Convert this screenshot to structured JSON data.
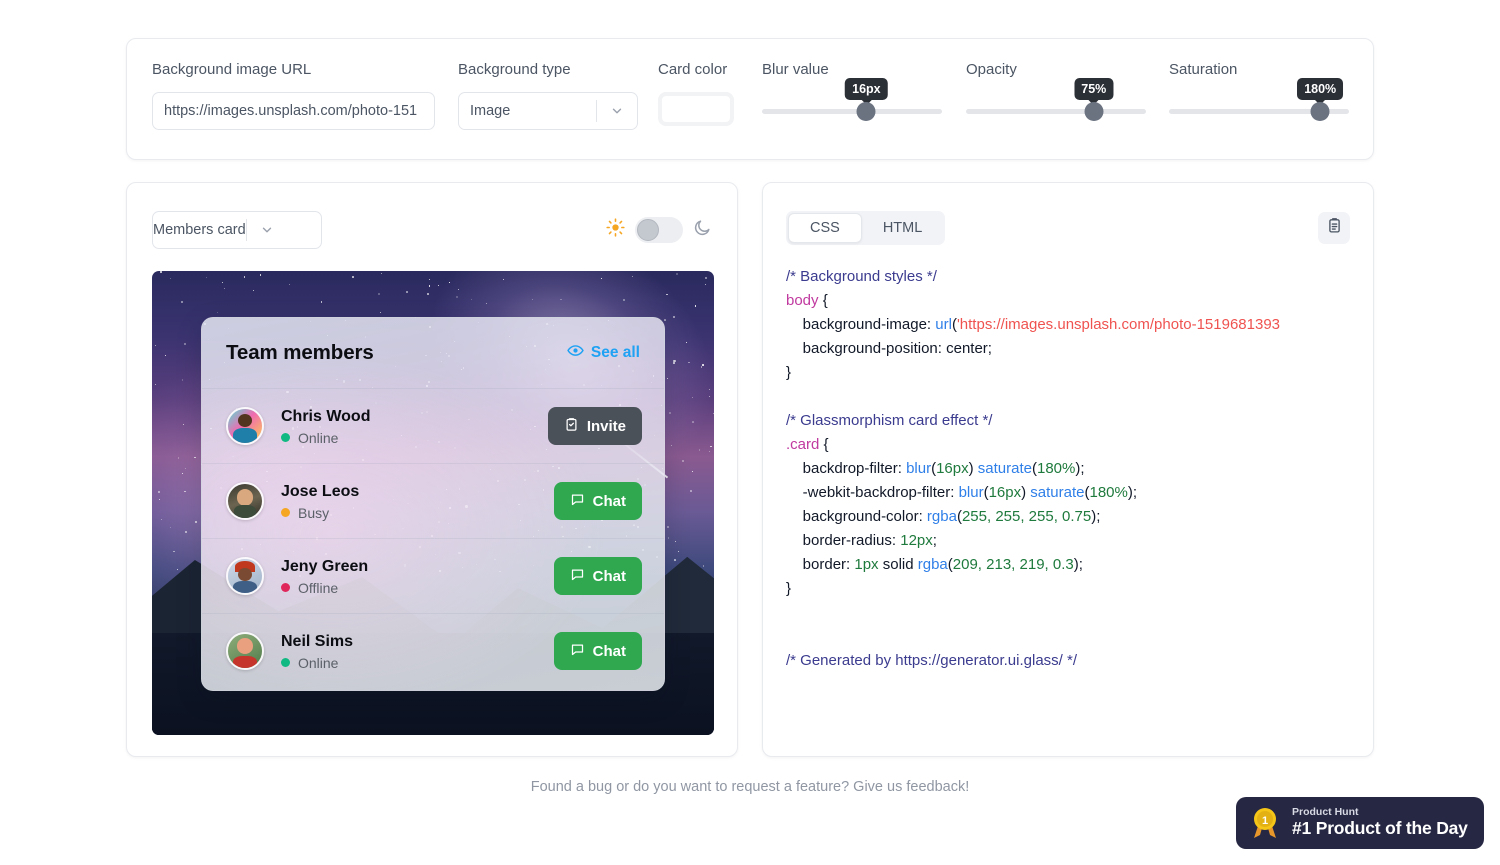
{
  "settings": {
    "background_url": {
      "label": "Background image URL",
      "value": "https://images.unsplash.com/photo-151"
    },
    "background_type": {
      "label": "Background type",
      "value": "Image"
    },
    "card_color": {
      "label": "Card color",
      "value": "#ffffff"
    },
    "blur": {
      "label": "Blur value",
      "value": "16px",
      "percent": 58
    },
    "opacity": {
      "label": "Opacity",
      "value": "75%",
      "percent": 71
    },
    "saturation": {
      "label": "Saturation",
      "value": "180%",
      "percent": 84
    }
  },
  "preview": {
    "component_select": "Members card",
    "theme": {
      "sun_icon": "sun-icon",
      "moon_icon": "moon-icon",
      "mode": "light"
    },
    "card": {
      "title": "Team members",
      "see_all": "See all",
      "see_all_icon": "eye-icon",
      "members": [
        {
          "name": "Chris Wood",
          "status": "Online",
          "status_color": "#10b981",
          "action": "Invite",
          "action_kind": "invite",
          "action_icon": "clipboard-check-icon"
        },
        {
          "name": "Jose Leos",
          "status": "Busy",
          "status_color": "#f5a623",
          "action": "Chat",
          "action_kind": "chat",
          "action_icon": "chat-bubble-icon"
        },
        {
          "name": "Jeny Green",
          "status": "Offline",
          "status_color": "#e0275c",
          "action": "Chat",
          "action_kind": "chat",
          "action_icon": "chat-bubble-icon"
        },
        {
          "name": "Neil Sims",
          "status": "Online",
          "status_color": "#10b981",
          "action": "Chat",
          "action_kind": "chat",
          "action_icon": "chat-bubble-icon"
        }
      ]
    }
  },
  "code": {
    "tabs": [
      {
        "label": "CSS",
        "active": true
      },
      {
        "label": "HTML",
        "active": false
      }
    ],
    "copy_icon": "clipboard-copy-icon",
    "lines": {
      "l1": "/* Background styles */",
      "l2_sel": "body",
      "l2_brace": " {",
      "l3_prop": "background-image",
      "l3_fn": "url",
      "l3_str": "'https://images.unsplash.com/photo-1519681393",
      "l4_prop": "background-position",
      "l4_val": " center;",
      "l5": "}",
      "l6": "/* Glassmorphism card effect */",
      "l7_sel": ".card",
      "l7_brace": " {",
      "l8_prop": "backdrop-filter",
      "l8_fn1": "blur",
      "l8_n1": "16px",
      "l8_fn2": "saturate",
      "l8_n2": "180%",
      "l9_prop": "-webkit-backdrop-filter",
      "l10_prop": "background-color",
      "l10_fn": "rgba",
      "l10_n": "255, 255, 255, 0.75",
      "l11_prop": "border-radius",
      "l11_n": "12px",
      "l12_prop": "border",
      "l12_n1": "1px",
      "l12_kw": " solid ",
      "l12_fn": "rgba",
      "l12_n2": "209, 213, 219, 0.3",
      "l13": "}",
      "l14": "/* Generated by https://generator.ui.glass/ */"
    }
  },
  "footer": {
    "text": "Found a bug or do you want to request a feature? Give us feedback!"
  },
  "product_hunt": {
    "small": "Product Hunt",
    "big": "#1 Product of the Day",
    "medal_number": "1"
  }
}
